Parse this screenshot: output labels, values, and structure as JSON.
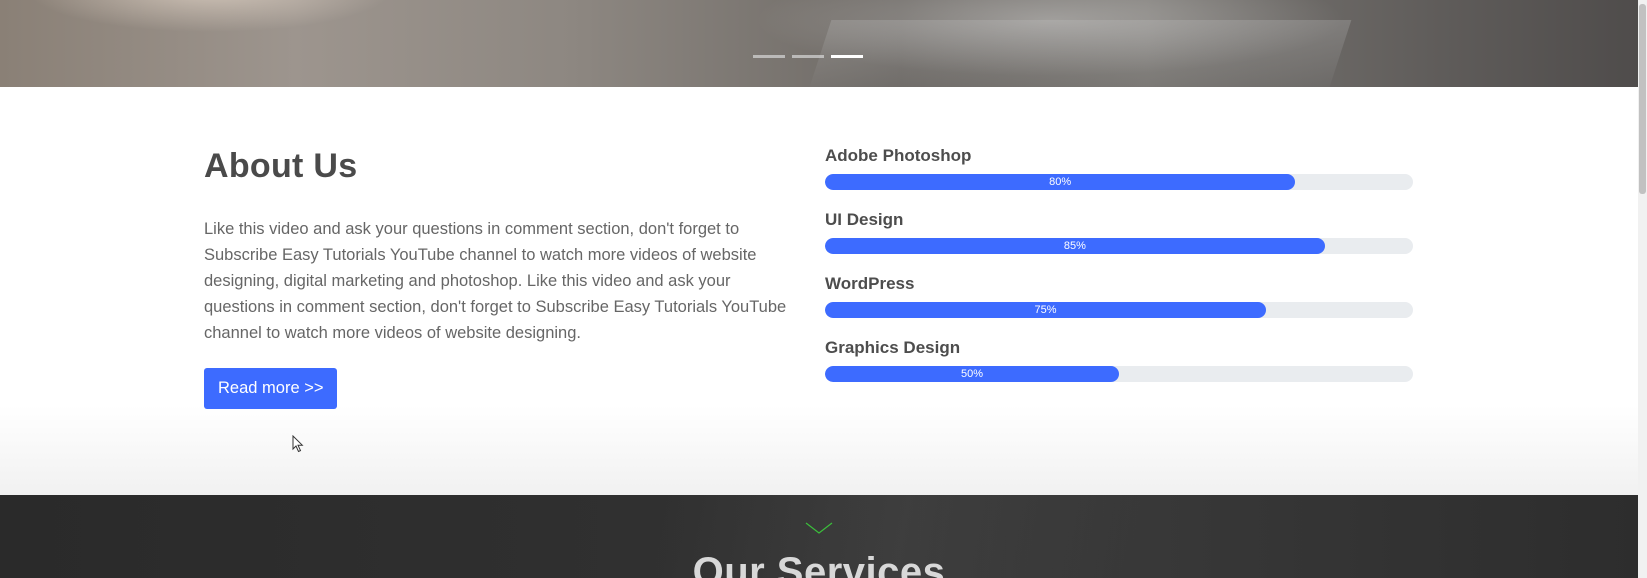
{
  "hero": {
    "slider_dot_count": 3,
    "active_slide": 3
  },
  "about": {
    "title": "About Us",
    "text": "Like this video and ask your questions in comment section, don't forget to Subscribe Easy Tutorials YouTube channel to watch more videos of website designing, digital marketing and photoshop. Like this video and ask your questions in comment section, don't forget to Subscribe Easy Tutorials YouTube channel to watch more videos of website designing.",
    "button_label": "Read more >>"
  },
  "skills": [
    {
      "name": "Adobe Photoshop",
      "percent": 80,
      "label": "80%"
    },
    {
      "name": "UI Design",
      "percent": 85,
      "label": "85%"
    },
    {
      "name": "WordPress",
      "percent": 75,
      "label": "75%"
    },
    {
      "name": "Graphics Design",
      "percent": 50,
      "label": "50%"
    }
  ],
  "services": {
    "title": "Our Services"
  },
  "colors": {
    "accent": "#3d6bff",
    "track": "#e9ecef",
    "heading": "#4a4a4a",
    "body_text": "#666666"
  },
  "icons": {
    "cursor": "mouse-pointer-icon",
    "divider": "chevron-down-icon"
  }
}
